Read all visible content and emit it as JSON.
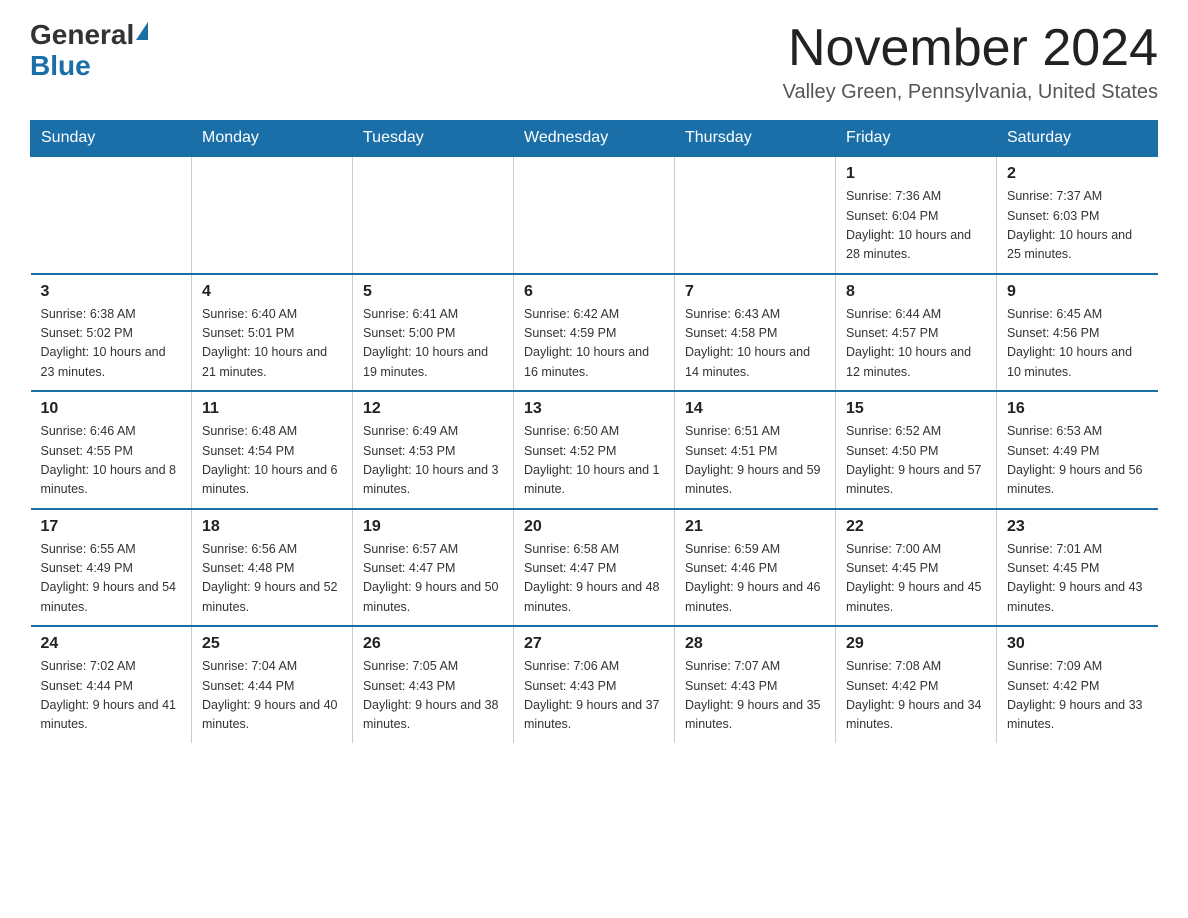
{
  "logo": {
    "general": "General",
    "blue": "Blue"
  },
  "header": {
    "month": "November 2024",
    "location": "Valley Green, Pennsylvania, United States"
  },
  "weekdays": [
    "Sunday",
    "Monday",
    "Tuesday",
    "Wednesday",
    "Thursday",
    "Friday",
    "Saturday"
  ],
  "rows": [
    [
      {
        "day": "",
        "info": ""
      },
      {
        "day": "",
        "info": ""
      },
      {
        "day": "",
        "info": ""
      },
      {
        "day": "",
        "info": ""
      },
      {
        "day": "",
        "info": ""
      },
      {
        "day": "1",
        "info": "Sunrise: 7:36 AM\nSunset: 6:04 PM\nDaylight: 10 hours\nand 28 minutes."
      },
      {
        "day": "2",
        "info": "Sunrise: 7:37 AM\nSunset: 6:03 PM\nDaylight: 10 hours\nand 25 minutes."
      }
    ],
    [
      {
        "day": "3",
        "info": "Sunrise: 6:38 AM\nSunset: 5:02 PM\nDaylight: 10 hours\nand 23 minutes."
      },
      {
        "day": "4",
        "info": "Sunrise: 6:40 AM\nSunset: 5:01 PM\nDaylight: 10 hours\nand 21 minutes."
      },
      {
        "day": "5",
        "info": "Sunrise: 6:41 AM\nSunset: 5:00 PM\nDaylight: 10 hours\nand 19 minutes."
      },
      {
        "day": "6",
        "info": "Sunrise: 6:42 AM\nSunset: 4:59 PM\nDaylight: 10 hours\nand 16 minutes."
      },
      {
        "day": "7",
        "info": "Sunrise: 6:43 AM\nSunset: 4:58 PM\nDaylight: 10 hours\nand 14 minutes."
      },
      {
        "day": "8",
        "info": "Sunrise: 6:44 AM\nSunset: 4:57 PM\nDaylight: 10 hours\nand 12 minutes."
      },
      {
        "day": "9",
        "info": "Sunrise: 6:45 AM\nSunset: 4:56 PM\nDaylight: 10 hours\nand 10 minutes."
      }
    ],
    [
      {
        "day": "10",
        "info": "Sunrise: 6:46 AM\nSunset: 4:55 PM\nDaylight: 10 hours\nand 8 minutes."
      },
      {
        "day": "11",
        "info": "Sunrise: 6:48 AM\nSunset: 4:54 PM\nDaylight: 10 hours\nand 6 minutes."
      },
      {
        "day": "12",
        "info": "Sunrise: 6:49 AM\nSunset: 4:53 PM\nDaylight: 10 hours\nand 3 minutes."
      },
      {
        "day": "13",
        "info": "Sunrise: 6:50 AM\nSunset: 4:52 PM\nDaylight: 10 hours\nand 1 minute."
      },
      {
        "day": "14",
        "info": "Sunrise: 6:51 AM\nSunset: 4:51 PM\nDaylight: 9 hours\nand 59 minutes."
      },
      {
        "day": "15",
        "info": "Sunrise: 6:52 AM\nSunset: 4:50 PM\nDaylight: 9 hours\nand 57 minutes."
      },
      {
        "day": "16",
        "info": "Sunrise: 6:53 AM\nSunset: 4:49 PM\nDaylight: 9 hours\nand 56 minutes."
      }
    ],
    [
      {
        "day": "17",
        "info": "Sunrise: 6:55 AM\nSunset: 4:49 PM\nDaylight: 9 hours\nand 54 minutes."
      },
      {
        "day": "18",
        "info": "Sunrise: 6:56 AM\nSunset: 4:48 PM\nDaylight: 9 hours\nand 52 minutes."
      },
      {
        "day": "19",
        "info": "Sunrise: 6:57 AM\nSunset: 4:47 PM\nDaylight: 9 hours\nand 50 minutes."
      },
      {
        "day": "20",
        "info": "Sunrise: 6:58 AM\nSunset: 4:47 PM\nDaylight: 9 hours\nand 48 minutes."
      },
      {
        "day": "21",
        "info": "Sunrise: 6:59 AM\nSunset: 4:46 PM\nDaylight: 9 hours\nand 46 minutes."
      },
      {
        "day": "22",
        "info": "Sunrise: 7:00 AM\nSunset: 4:45 PM\nDaylight: 9 hours\nand 45 minutes."
      },
      {
        "day": "23",
        "info": "Sunrise: 7:01 AM\nSunset: 4:45 PM\nDaylight: 9 hours\nand 43 minutes."
      }
    ],
    [
      {
        "day": "24",
        "info": "Sunrise: 7:02 AM\nSunset: 4:44 PM\nDaylight: 9 hours\nand 41 minutes."
      },
      {
        "day": "25",
        "info": "Sunrise: 7:04 AM\nSunset: 4:44 PM\nDaylight: 9 hours\nand 40 minutes."
      },
      {
        "day": "26",
        "info": "Sunrise: 7:05 AM\nSunset: 4:43 PM\nDaylight: 9 hours\nand 38 minutes."
      },
      {
        "day": "27",
        "info": "Sunrise: 7:06 AM\nSunset: 4:43 PM\nDaylight: 9 hours\nand 37 minutes."
      },
      {
        "day": "28",
        "info": "Sunrise: 7:07 AM\nSunset: 4:43 PM\nDaylight: 9 hours\nand 35 minutes."
      },
      {
        "day": "29",
        "info": "Sunrise: 7:08 AM\nSunset: 4:42 PM\nDaylight: 9 hours\nand 34 minutes."
      },
      {
        "day": "30",
        "info": "Sunrise: 7:09 AM\nSunset: 4:42 PM\nDaylight: 9 hours\nand 33 minutes."
      }
    ]
  ]
}
